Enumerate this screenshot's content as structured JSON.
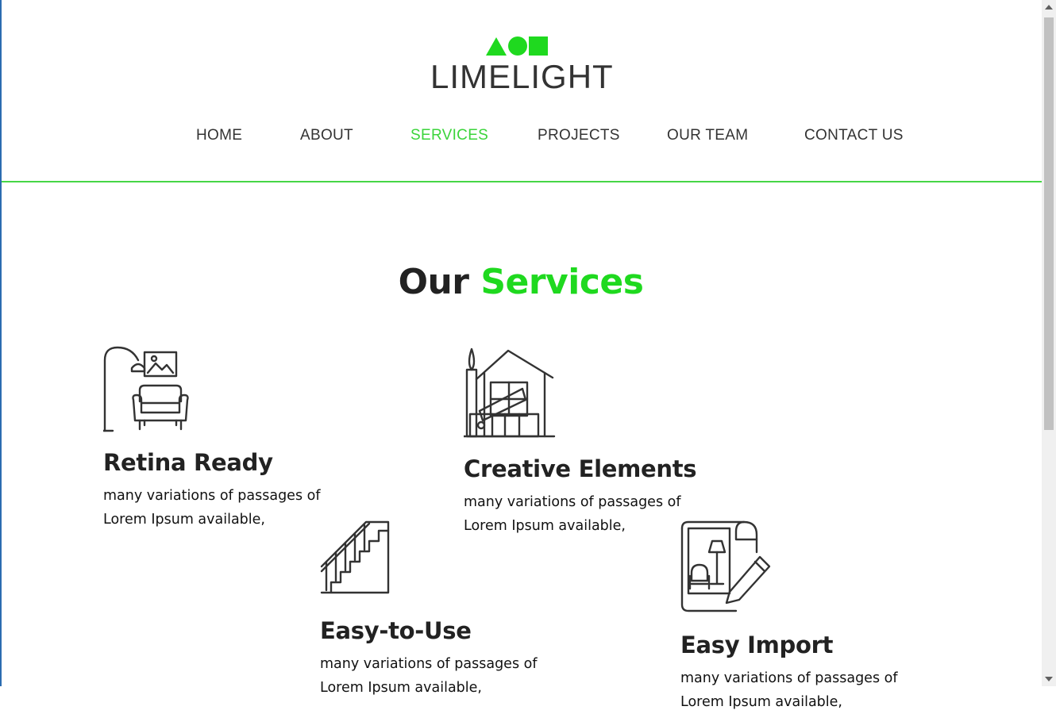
{
  "brand": {
    "name": "LIMELIGHT",
    "accent": "#1fd91f",
    "shapes_color": "#1fd91f"
  },
  "nav": {
    "items": [
      {
        "label": "HOME"
      },
      {
        "label": "ABOUT"
      },
      {
        "label": "SERVICES",
        "active": true
      },
      {
        "label": "PROJECTS"
      },
      {
        "label": "OUR TEAM"
      },
      {
        "label": "CONTACT US"
      }
    ]
  },
  "section": {
    "heading_part1": "Our",
    "heading_part2": "Services"
  },
  "services": [
    {
      "title": "Retina Ready",
      "icon": "lamp-armchair-icon",
      "desc": "many variations of passages of Lorem Ipsum available,"
    },
    {
      "title": "Creative Elements",
      "icon": "house-design-icon",
      "desc": "many variations of passages of Lorem Ipsum available,"
    },
    {
      "title": "Easy-to-Use",
      "icon": "staircase-icon",
      "desc": "many variations of passages of Lorem Ipsum available,"
    },
    {
      "title": "Easy Import",
      "icon": "blueprint-pencil-icon",
      "desc": "many variations of passages of Lorem Ipsum available,"
    }
  ]
}
